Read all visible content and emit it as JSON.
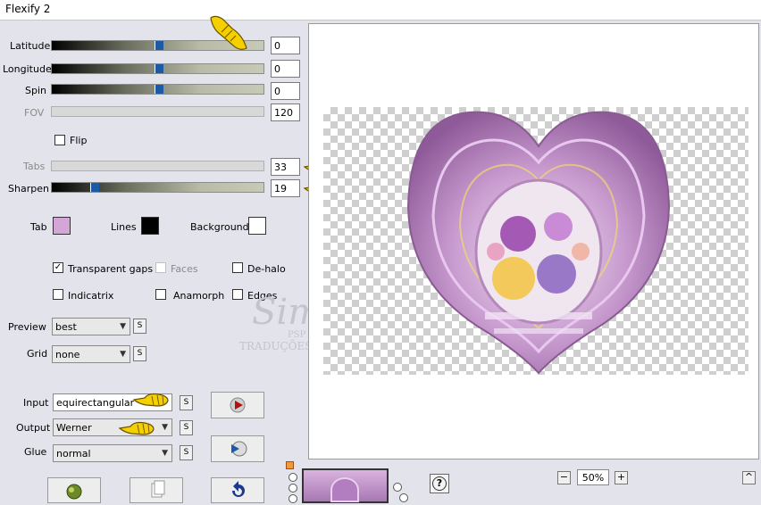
{
  "window": {
    "title": "Flexify 2"
  },
  "sliders": [
    {
      "label": "Latitude",
      "value": "0",
      "level": 0.5,
      "enabled": true
    },
    {
      "label": "Longitude",
      "value": "0",
      "level": 0.5,
      "enabled": true
    },
    {
      "label": "Spin",
      "value": "0",
      "level": 0.5,
      "enabled": true
    },
    {
      "label": "FOV",
      "value": "120",
      "enabled": false
    },
    {
      "label": "Tabs",
      "value": "33",
      "enabled": false
    },
    {
      "label": "Sharpen",
      "value": "19",
      "level": 0.19,
      "enabled": true
    }
  ],
  "flip": {
    "label": "Flip",
    "checked": false
  },
  "colors": {
    "tab": {
      "label": "Tab",
      "color": "#d4a6d8"
    },
    "lines": {
      "label": "Lines",
      "color": "#000000"
    },
    "background": {
      "label": "Background",
      "color": "#ffffff"
    }
  },
  "options": {
    "transparent_gaps": {
      "label": "Transparent gaps",
      "checked": true
    },
    "faces": {
      "label": "Faces",
      "checked": false,
      "enabled": false
    },
    "de_halo": {
      "label": "De-halo",
      "checked": false
    },
    "indicatrix": {
      "label": "Indicatrix",
      "checked": false
    },
    "anamorph": {
      "label": "Anamorph",
      "checked": false
    },
    "edges": {
      "label": "Edges",
      "checked": false
    }
  },
  "preview_select": {
    "label": "Preview",
    "value": "best"
  },
  "grid_select": {
    "label": "Grid",
    "value": "none"
  },
  "input_select": {
    "label": "Input",
    "value": "equirectangular"
  },
  "output_select": {
    "label": "Output",
    "value": "Werner"
  },
  "glue_select": {
    "label": "Glue",
    "value": "normal"
  },
  "s_button_label": "S",
  "zoom": {
    "value": "50%",
    "minus": "−",
    "plus": "+"
  },
  "help_label": "?",
  "collapse_label": "^",
  "watermark": {
    "line1": "Sim",
    "line2": "PSP",
    "line3": "TRADUÇÕES"
  },
  "accent": {
    "slider_thumb": "#1d5aa6",
    "pointer_hand": "#f5d000"
  }
}
